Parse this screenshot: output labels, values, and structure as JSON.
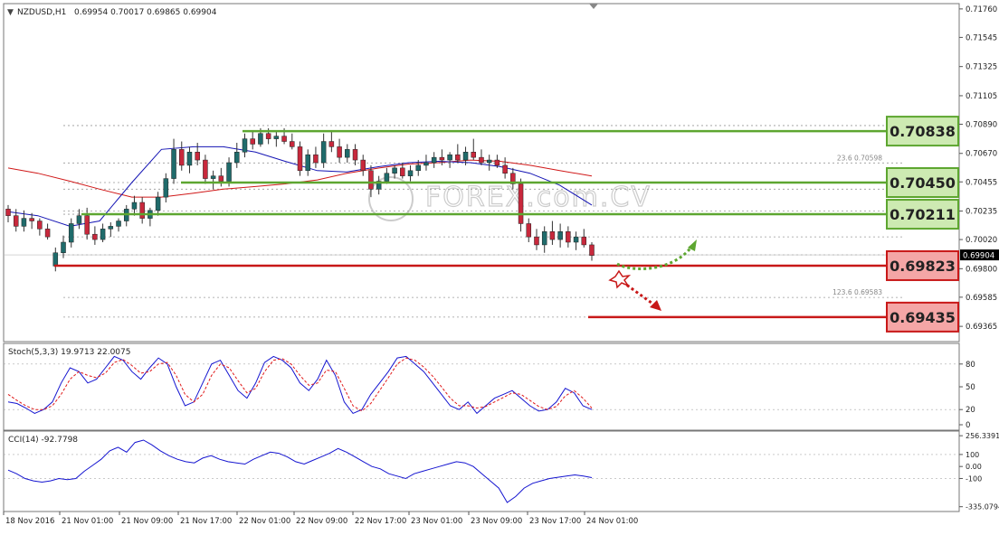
{
  "header": {
    "symbol": "NZDUSD,H1",
    "ohlc": "0.69954 0.70017 0.69865 0.69904"
  },
  "watermark": "FOREX.com.CV",
  "colors": {
    "up_body": "#1f6b6b",
    "down_body": "#c8283c",
    "wick": "#333333",
    "ma_fast": "#1414b4",
    "ma_slow": "#d01818",
    "green_level": "#5da630",
    "red_level": "#c81818",
    "green_label_bg": "#cdeab2",
    "red_label_bg": "#f4a6a6",
    "stoch_main": "#1414d0",
    "stoch_signal": "#e01818",
    "cci": "#1414d0"
  },
  "chart_data": [
    {
      "type": "candlestick",
      "panel": "main",
      "title": "NZDUSD,H1",
      "ylim": [
        0.6925,
        0.718
      ],
      "y_ticks": [
        "0.71760",
        "0.71545",
        "0.71325",
        "0.71105",
        "0.70890",
        "0.70670",
        "0.70455",
        "0.70235",
        "0.70020",
        "0.69800",
        "0.69585",
        "0.69365"
      ],
      "x_ticks": [
        "18 Nov 2016",
        "21 Nov 01:00",
        "21 Nov 09:00",
        "21 Nov 17:00",
        "22 Nov 01:00",
        "22 Nov 09:00",
        "22 Nov 17:00",
        "23 Nov 01:00",
        "23 Nov 09:00",
        "23 Nov 17:00",
        "24 Nov 01:00"
      ],
      "current_price": "0.69904",
      "candles": [
        [
          0.7025,
          0.7028,
          0.7015,
          0.702
        ],
        [
          0.702,
          0.7025,
          0.7008,
          0.7012
        ],
        [
          0.7012,
          0.7024,
          0.7008,
          0.7018
        ],
        [
          0.7018,
          0.7022,
          0.701,
          0.7016
        ],
        [
          0.7016,
          0.7018,
          0.7005,
          0.701
        ],
        [
          0.701,
          0.7014,
          0.7002,
          0.7004
        ],
        [
          0.6982,
          0.6996,
          0.6978,
          0.6992
        ],
        [
          0.6992,
          0.7005,
          0.6988,
          0.7
        ],
        [
          0.7,
          0.7018,
          0.6996,
          0.7014
        ],
        [
          0.7014,
          0.7025,
          0.701,
          0.702
        ],
        [
          0.702,
          0.7026,
          0.7002,
          0.7006
        ],
        [
          0.7006,
          0.7012,
          0.6998,
          0.7002
        ],
        [
          0.7002,
          0.7014,
          0.7,
          0.701
        ],
        [
          0.701,
          0.7015,
          0.7004,
          0.7012
        ],
        [
          0.7012,
          0.7018,
          0.7008,
          0.7016
        ],
        [
          0.7016,
          0.7028,
          0.7012,
          0.7025
        ],
        [
          0.7025,
          0.7035,
          0.702,
          0.703
        ],
        [
          0.703,
          0.7034,
          0.7014,
          0.7018
        ],
        [
          0.7018,
          0.7026,
          0.7012,
          0.7024
        ],
        [
          0.7024,
          0.7038,
          0.702,
          0.7034
        ],
        [
          0.7034,
          0.7052,
          0.703,
          0.7048
        ],
        [
          0.7048,
          0.7078,
          0.7044,
          0.707
        ],
        [
          0.707,
          0.7076,
          0.7054,
          0.7058
        ],
        [
          0.7058,
          0.7072,
          0.7052,
          0.7068
        ],
        [
          0.7068,
          0.7075,
          0.7058,
          0.7062
        ],
        [
          0.7062,
          0.7066,
          0.7044,
          0.7048
        ],
        [
          0.7048,
          0.7054,
          0.704,
          0.705
        ],
        [
          0.705,
          0.7056,
          0.7042,
          0.7046
        ],
        [
          0.7046,
          0.7064,
          0.7042,
          0.706
        ],
        [
          0.706,
          0.7075,
          0.7056,
          0.7068
        ],
        [
          0.7068,
          0.7082,
          0.7064,
          0.7078
        ],
        [
          0.7078,
          0.7084,
          0.707,
          0.7074
        ],
        [
          0.7074,
          0.7086,
          0.7072,
          0.7082
        ],
        [
          0.7082,
          0.7086,
          0.7074,
          0.7078
        ],
        [
          0.7078,
          0.7084,
          0.7072,
          0.708
        ],
        [
          0.708,
          0.7086,
          0.7074,
          0.7076
        ],
        [
          0.7076,
          0.7082,
          0.707,
          0.7072
        ],
        [
          0.7072,
          0.7076,
          0.705,
          0.7054
        ],
        [
          0.7054,
          0.707,
          0.705,
          0.7066
        ],
        [
          0.7066,
          0.7072,
          0.7056,
          0.706
        ],
        [
          0.706,
          0.7082,
          0.7056,
          0.7076
        ],
        [
          0.7076,
          0.7084,
          0.7068,
          0.7072
        ],
        [
          0.7072,
          0.7078,
          0.706,
          0.7064
        ],
        [
          0.7064,
          0.7074,
          0.706,
          0.707
        ],
        [
          0.707,
          0.7074,
          0.7058,
          0.7062
        ],
        [
          0.7062,
          0.7066,
          0.705,
          0.7054
        ],
        [
          0.7054,
          0.7058,
          0.7034,
          0.704
        ],
        [
          0.704,
          0.705,
          0.7036,
          0.7046
        ],
        [
          0.7046,
          0.7056,
          0.7044,
          0.7052
        ],
        [
          0.7052,
          0.7058,
          0.7048,
          0.7056
        ],
        [
          0.7056,
          0.706,
          0.7048,
          0.705
        ],
        [
          0.705,
          0.7058,
          0.7046,
          0.7054
        ],
        [
          0.7054,
          0.7062,
          0.705,
          0.7058
        ],
        [
          0.7058,
          0.7066,
          0.7054,
          0.706
        ],
        [
          0.706,
          0.7068,
          0.7056,
          0.7064
        ],
        [
          0.7064,
          0.707,
          0.7058,
          0.7062
        ],
        [
          0.7062,
          0.7068,
          0.7056,
          0.7066
        ],
        [
          0.7066,
          0.7074,
          0.706,
          0.7062
        ],
        [
          0.7062,
          0.7072,
          0.7058,
          0.7068
        ],
        [
          0.7068,
          0.7078,
          0.7062,
          0.7064
        ],
        [
          0.7064,
          0.707,
          0.7058,
          0.706
        ],
        [
          0.706,
          0.7066,
          0.7054,
          0.7062
        ],
        [
          0.7062,
          0.7066,
          0.7056,
          0.7058
        ],
        [
          0.7058,
          0.7064,
          0.7048,
          0.7052
        ],
        [
          0.7052,
          0.7056,
          0.704,
          0.7044
        ],
        [
          0.7044,
          0.7048,
          0.7008,
          0.7014
        ],
        [
          0.7014,
          0.7018,
          0.7,
          0.7004
        ],
        [
          0.7004,
          0.701,
          0.6994,
          0.6998
        ],
        [
          0.6998,
          0.7012,
          0.6992,
          0.7008
        ],
        [
          0.7008,
          0.7016,
          0.6998,
          0.7002
        ],
        [
          0.7002,
          0.7014,
          0.6996,
          0.7008
        ],
        [
          0.7008,
          0.7012,
          0.6996,
          0.7
        ],
        [
          0.7,
          0.7008,
          0.6994,
          0.7004
        ],
        [
          0.7004,
          0.701,
          0.6996,
          0.6998
        ],
        [
          0.6998,
          0.7,
          0.6986,
          0.699
        ]
      ],
      "ma_fast": [
        [
          0,
          0.7023
        ],
        [
          12,
          0.702
        ],
        [
          25,
          0.7012
        ],
        [
          37,
          0.7016
        ],
        [
          50,
          0.7045
        ],
        [
          62,
          0.707
        ],
        [
          75,
          0.7072
        ],
        [
          87,
          0.7072
        ],
        [
          100,
          0.7068
        ],
        [
          112,
          0.7061
        ],
        [
          125,
          0.7054
        ],
        [
          137,
          0.7053
        ],
        [
          150,
          0.7057
        ],
        [
          162,
          0.706
        ],
        [
          174,
          0.7061
        ],
        [
          187,
          0.706
        ],
        [
          199,
          0.7057
        ],
        [
          211,
          0.7052
        ],
        [
          223,
          0.7043
        ],
        [
          236,
          0.7028
        ]
      ],
      "ma_slow": [
        [
          0,
          0.7056
        ],
        [
          12,
          0.7052
        ],
        [
          25,
          0.7046
        ],
        [
          37,
          0.704
        ],
        [
          50,
          0.7034
        ],
        [
          62,
          0.7034
        ],
        [
          75,
          0.7037
        ],
        [
          87,
          0.704
        ],
        [
          100,
          0.7042
        ],
        [
          112,
          0.7044
        ],
        [
          125,
          0.7047
        ],
        [
          137,
          0.7052
        ],
        [
          150,
          0.7056
        ],
        [
          162,
          0.7059
        ],
        [
          174,
          0.706
        ],
        [
          187,
          0.7062
        ],
        [
          199,
          0.7061
        ],
        [
          211,
          0.7058
        ],
        [
          223,
          0.7054
        ],
        [
          236,
          0.705
        ]
      ],
      "fib_labels": [
        {
          "text": "23.6  0.70598",
          "value": 0.70598
        },
        {
          "text": "123.6  0.69583",
          "value": 0.69583
        }
      ],
      "levels": [
        {
          "label": "0.70838",
          "value": 0.70838,
          "kind": "green"
        },
        {
          "label": "0.70450",
          "value": 0.7045,
          "kind": "green"
        },
        {
          "label": "0.70211",
          "value": 0.70211,
          "kind": "green"
        },
        {
          "label": "0.69823",
          "value": 0.69823,
          "kind": "red"
        },
        {
          "label": "0.69435",
          "value": 0.69435,
          "kind": "red"
        }
      ]
    },
    {
      "type": "line",
      "panel": "stochastic",
      "title": "Stoch(5,3,3) 19.9713 22.0075",
      "ylim": [
        0,
        100
      ],
      "y_ticks": [
        "80",
        "50",
        "20",
        "0"
      ],
      "series": [
        {
          "name": "main",
          "values": [
            30,
            28,
            22,
            15,
            20,
            30,
            55,
            75,
            70,
            55,
            60,
            75,
            90,
            85,
            70,
            60,
            75,
            88,
            80,
            50,
            25,
            30,
            55,
            80,
            85,
            65,
            45,
            35,
            55,
            82,
            90,
            85,
            75,
            55,
            45,
            60,
            85,
            65,
            30,
            15,
            20,
            40,
            55,
            70,
            88,
            90,
            80,
            70,
            55,
            40,
            25,
            20,
            30,
            15,
            25,
            35,
            40,
            45,
            35,
            25,
            18,
            20,
            30,
            48,
            42,
            25,
            20
          ]
        },
        {
          "name": "signal",
          "values": [
            40,
            32,
            25,
            20,
            20,
            25,
            40,
            60,
            70,
            65,
            62,
            68,
            82,
            86,
            78,
            68,
            70,
            80,
            82,
            65,
            40,
            30,
            40,
            65,
            80,
            75,
            58,
            42,
            48,
            70,
            85,
            87,
            80,
            65,
            52,
            55,
            72,
            70,
            48,
            25,
            18,
            28,
            45,
            62,
            80,
            88,
            85,
            76,
            64,
            50,
            35,
            25,
            25,
            22,
            24,
            30,
            36,
            42,
            40,
            32,
            24,
            20,
            24,
            38,
            45,
            35,
            22
          ]
        }
      ]
    },
    {
      "type": "line",
      "panel": "cci",
      "title": "CCI(14) -92.7798",
      "ylim": [
        -360,
        280
      ],
      "y_ticks": [
        "256.3391",
        "100",
        "0.00",
        "-100",
        "-335.0794"
      ],
      "series": [
        {
          "name": "CCI",
          "values": [
            -30,
            -60,
            -100,
            -120,
            -130,
            -120,
            -100,
            -110,
            -100,
            -40,
            10,
            60,
            130,
            160,
            120,
            200,
            220,
            180,
            130,
            90,
            60,
            40,
            30,
            70,
            90,
            60,
            40,
            30,
            20,
            60,
            90,
            120,
            110,
            80,
            40,
            20,
            50,
            80,
            110,
            150,
            120,
            80,
            40,
            0,
            -20,
            -60,
            -80,
            -100,
            -60,
            -40,
            -20,
            0,
            20,
            40,
            30,
            0,
            -60,
            -120,
            -180,
            -300,
            -250,
            -180,
            -140,
            -120,
            -100,
            -90,
            -80,
            -70,
            -80,
            -93
          ]
        }
      ]
    }
  ]
}
